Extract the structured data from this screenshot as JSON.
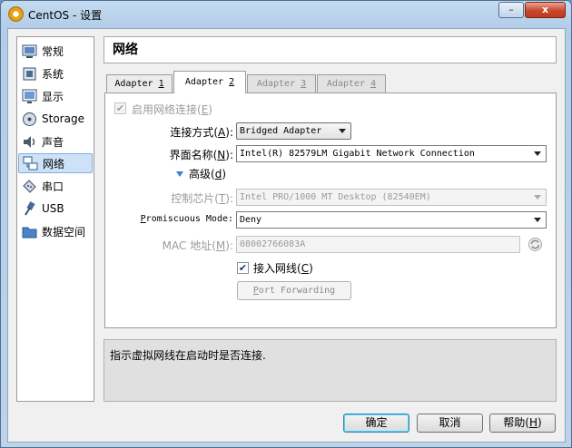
{
  "window": {
    "title": "CentOS - 设置",
    "min_label": "–",
    "close_label": "x",
    "accent": "#cde2f7"
  },
  "sidebar": {
    "items": [
      {
        "label": "常规",
        "icon": "general-icon"
      },
      {
        "label": "系统",
        "icon": "system-chip-icon"
      },
      {
        "label": "显示",
        "icon": "display-monitor-icon"
      },
      {
        "label": "Storage",
        "icon": "storage-disk-icon"
      },
      {
        "label": "声音",
        "icon": "speaker-icon"
      },
      {
        "label": "网络",
        "icon": "network-icon",
        "selected": true
      },
      {
        "label": "串口",
        "icon": "serial-port-icon"
      },
      {
        "label": "USB",
        "icon": "usb-icon"
      },
      {
        "label": "数据空间",
        "icon": "shared-folder-icon"
      }
    ]
  },
  "header": {
    "title": "网络"
  },
  "tabs": [
    {
      "label_pre": "Adapter ",
      "key": "1"
    },
    {
      "label_pre": "Adapter ",
      "key": "2",
      "active": true
    },
    {
      "label_pre": "Adapter ",
      "key": "3"
    },
    {
      "label_pre": "Adapter ",
      "key": "4"
    }
  ],
  "form": {
    "enable": {
      "label": "启用网络连接(",
      "key": "E",
      "suffix": ")",
      "checked": true
    },
    "attached": {
      "label": "连接方式(",
      "key": "A",
      "suffix": "):",
      "value": "Bridged Adapter"
    },
    "iface": {
      "label": "界面名称(",
      "key": "N",
      "suffix": "):",
      "value": "Intel(R) 82579LM Gigabit Network Connection"
    },
    "advanced": {
      "label": "高级(",
      "key": "d",
      "suffix": ")"
    },
    "adapter_type": {
      "label": "控制芯片(",
      "key": "T",
      "suffix": "):",
      "value": "Intel PRO/1000 MT Desktop (82540EM)"
    },
    "promisc": {
      "key": "P",
      "label": "romiscuous Mode:",
      "value": "Deny"
    },
    "mac": {
      "label": "MAC 地址(",
      "key": "M",
      "suffix": "):",
      "value": "08002766083A"
    },
    "cable": {
      "label": "接入网线(",
      "key": "C",
      "suffix": ")",
      "checked": true
    },
    "port_forwarding": {
      "key": "P",
      "label": "ort Forwarding"
    }
  },
  "description": "指示虚拟网线在启动时是否连接.",
  "buttons": {
    "ok": "确定",
    "cancel": "取消",
    "help_pre": "帮助(",
    "help_key": "H",
    "help_suffix": ")"
  },
  "check_mark": "✔"
}
